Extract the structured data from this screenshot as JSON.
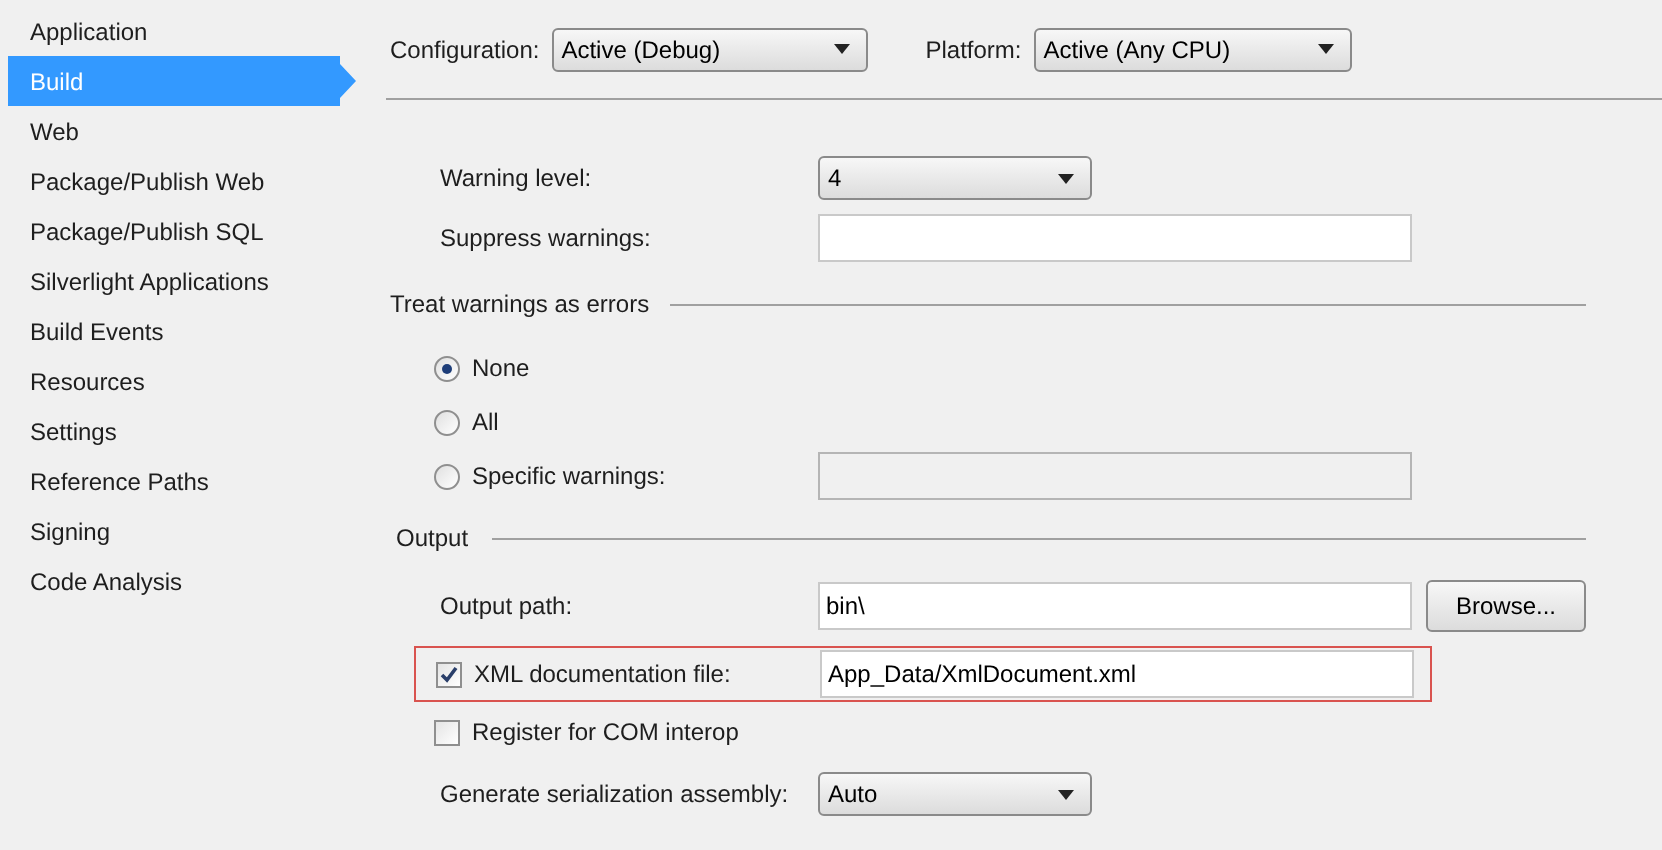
{
  "sidebar": {
    "items": [
      {
        "label": "Application",
        "selected": false
      },
      {
        "label": "Build",
        "selected": true
      },
      {
        "label": "Web",
        "selected": false
      },
      {
        "label": "Package/Publish Web",
        "selected": false
      },
      {
        "label": "Package/Publish SQL",
        "selected": false
      },
      {
        "label": "Silverlight Applications",
        "selected": false
      },
      {
        "label": "Build Events",
        "selected": false
      },
      {
        "label": "Resources",
        "selected": false
      },
      {
        "label": "Settings",
        "selected": false
      },
      {
        "label": "Reference Paths",
        "selected": false
      },
      {
        "label": "Signing",
        "selected": false
      },
      {
        "label": "Code Analysis",
        "selected": false
      }
    ]
  },
  "header": {
    "configuration": {
      "label": "Configuration:",
      "value": "Active (Debug)"
    },
    "platform": {
      "label": "Platform:",
      "value": "Active (Any CPU)"
    }
  },
  "errors_and_warnings": {
    "warning_level": {
      "label": "Warning level:",
      "value": "4"
    },
    "suppress_warnings": {
      "label": "Suppress warnings:"
    }
  },
  "treat_warnings_as_errors": {
    "title": "Treat warnings as errors",
    "options": [
      {
        "label": "None",
        "selected": true,
        "kind": "plain"
      },
      {
        "label": "All",
        "selected": false,
        "kind": "plain"
      },
      {
        "label": "Specific warnings:",
        "selected": false,
        "kind": "field"
      }
    ],
    "specific_field": {
      "disabled": true
    }
  },
  "output": {
    "title": "Output",
    "output_path": {
      "label": "Output path:",
      "value": "bin\\",
      "button": "Browse..."
    },
    "xml_documentation": {
      "label": "XML documentation file:",
      "checked": true,
      "value": "App_Data/XmlDocument.xml",
      "highlighted": true
    },
    "com_interop": {
      "label": "Register for COM interop",
      "checked": false
    },
    "serialization": {
      "label": "Generate serialization assembly:",
      "value": "Auto"
    }
  }
}
